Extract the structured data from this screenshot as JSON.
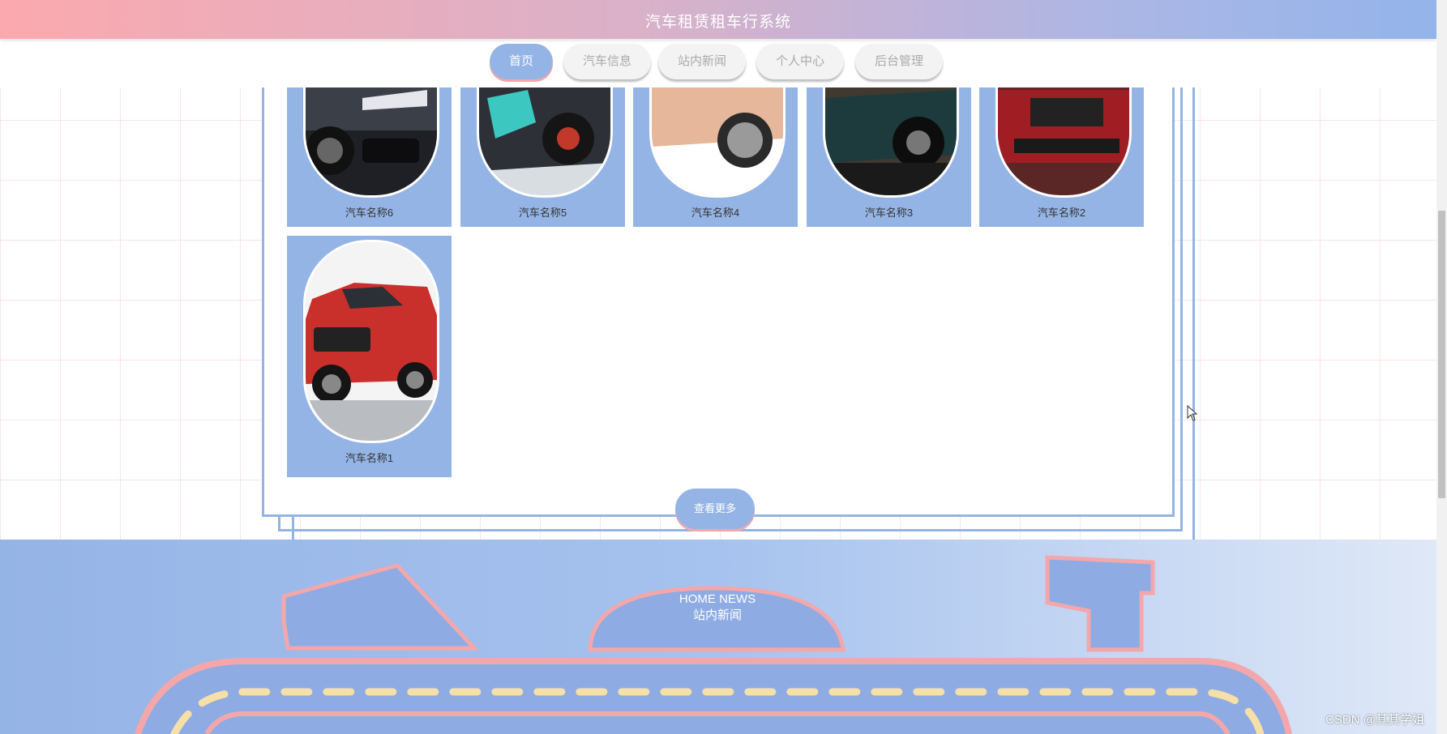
{
  "header": {
    "title": "汽车租赁租车行系统"
  },
  "nav": {
    "items": [
      {
        "label": "首页",
        "active": true
      },
      {
        "label": "汽车信息"
      },
      {
        "label": "站内新闻"
      },
      {
        "label": "个人中心"
      },
      {
        "label": "后台管理"
      }
    ]
  },
  "products": {
    "cards": [
      {
        "name": "汽车名称6"
      },
      {
        "name": "汽车名称5"
      },
      {
        "name": "汽车名称4"
      },
      {
        "name": "汽车名称3"
      },
      {
        "name": "汽车名称2"
      },
      {
        "name": "汽车名称1"
      }
    ],
    "more_label": "查看更多"
  },
  "news": {
    "title_en": "HOME NEWS",
    "title_cn": "站内新闻"
  },
  "watermark": "CSDN @其其学姐",
  "colors": {
    "accent": "#95b4e6",
    "pink": "#f4a7ab"
  }
}
